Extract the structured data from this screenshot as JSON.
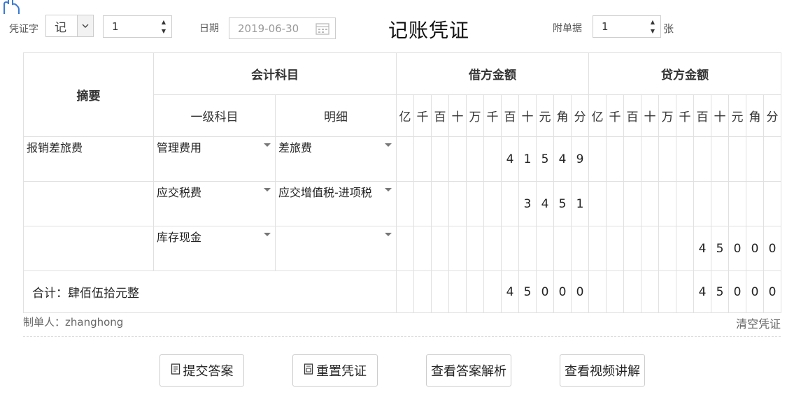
{
  "header": {
    "voucher_word_label": "凭证字",
    "voucher_word_value": "记",
    "voucher_no_value": "1",
    "date_label": "日期",
    "date_value": "2019-06-30",
    "title": "记账凭证",
    "attachments_label": "附单据",
    "attachments_value": "1",
    "attachments_unit": "张"
  },
  "table": {
    "summary_header": "摘要",
    "account_header": "会计科目",
    "debit_header": "借方金额",
    "credit_header": "贷方金额",
    "level1_header": "一级科目",
    "detail_header": "明细",
    "digit_headers": [
      "亿",
      "千",
      "百",
      "十",
      "万",
      "千",
      "百",
      "十",
      "元",
      "角",
      "分"
    ],
    "rows": [
      {
        "summary": "报销差旅费",
        "level1": "管理费用",
        "detail": "差旅费",
        "debit": [
          "",
          "",
          "",
          "",
          "",
          "",
          "4",
          "1",
          "5",
          "4",
          "9"
        ],
        "credit": [
          "",
          "",
          "",
          "",
          "",
          "",
          "",
          "",
          "",
          "",
          ""
        ]
      },
      {
        "summary": "",
        "level1": "应交税费",
        "detail": "应交增值税-进项税",
        "debit": [
          "",
          "",
          "",
          "",
          "",
          "",
          "",
          "3",
          "4",
          "5",
          "1"
        ],
        "credit": [
          "",
          "",
          "",
          "",
          "",
          "",
          "",
          "",
          "",
          "",
          ""
        ]
      },
      {
        "summary": "",
        "level1": "库存现金",
        "detail": "",
        "debit": [
          "",
          "",
          "",
          "",
          "",
          "",
          "",
          "",
          "",
          "",
          ""
        ],
        "credit": [
          "",
          "",
          "",
          "",
          "",
          "",
          "4",
          "5",
          "0",
          "0",
          "0"
        ]
      }
    ],
    "total_label": "合计：肆佰伍拾元整",
    "total_debit": [
      "",
      "",
      "",
      "",
      "",
      "",
      "4",
      "5",
      "0",
      "0",
      "0"
    ],
    "total_credit": [
      "",
      "",
      "",
      "",
      "",
      "",
      "4",
      "5",
      "0",
      "0",
      "0"
    ]
  },
  "footer": {
    "maker": "制单人：zhanghong",
    "clear": "清空凭证"
  },
  "buttons": {
    "submit": "提交答案",
    "reset": "重置凭证",
    "answer": "查看答案解析",
    "video": "查看视频讲解"
  }
}
